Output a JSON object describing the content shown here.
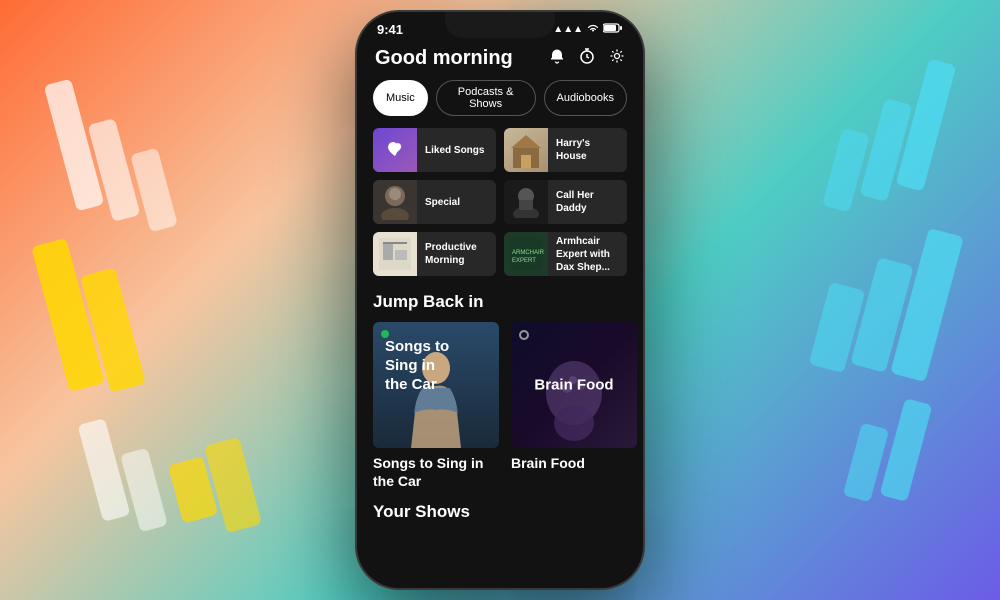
{
  "background": {
    "colors": [
      "#ff6b35",
      "#f7931e",
      "#4ecdc4",
      "#6c5ce7",
      "#ffd700"
    ]
  },
  "status_bar": {
    "time": "9:41",
    "signal": "●●●",
    "wifi": "wifi",
    "battery": "battery"
  },
  "header": {
    "greeting": "Good morning",
    "bell_icon": "🔔",
    "timer_icon": "⏱",
    "settings_icon": "⚙"
  },
  "filter_tabs": [
    {
      "label": "Music",
      "active": true
    },
    {
      "label": "Podcasts & Shows",
      "active": false
    },
    {
      "label": "Audiobooks",
      "active": false
    }
  ],
  "quick_items": [
    {
      "id": "liked-songs",
      "label": "Liked Songs",
      "thumb_type": "liked"
    },
    {
      "id": "harrys-house",
      "label": "Harry's House",
      "thumb_type": "harrys"
    },
    {
      "id": "special",
      "label": "Special",
      "thumb_type": "special"
    },
    {
      "id": "call-her-daddy",
      "label": "Call Her Daddy",
      "thumb_type": "callher"
    },
    {
      "id": "productive-morning",
      "label": "Productive Morning",
      "thumb_type": "productive"
    },
    {
      "id": "armchair-expert",
      "label": "Armhcair Expert with Dax Shep...",
      "thumb_type": "armchair"
    }
  ],
  "jump_back_section": {
    "title": "Jump Back in",
    "cards": [
      {
        "id": "songs-car",
        "title": "Songs to Sing in the Car",
        "thumb": "songs"
      },
      {
        "id": "brain-food",
        "title": "Brain Food",
        "thumb": "brain"
      }
    ]
  },
  "your_shows_section": {
    "title": "Your Shows"
  }
}
